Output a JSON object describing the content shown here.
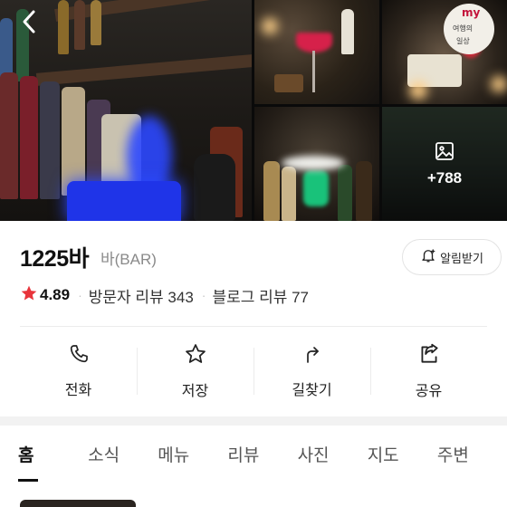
{
  "header": {
    "back_icon": "chevron-left-icon"
  },
  "gallery": {
    "more_photos_label": "+788",
    "more_photos_icon": "image-icon"
  },
  "place": {
    "name": "1225바",
    "category": "바(BAR)",
    "notify_label": "알림받기",
    "notify_icon": "bell-plus-icon",
    "rating": "4.89",
    "star_color": "#e8343b",
    "visitor_reviews": "방문자 리뷰 343",
    "blog_reviews": "블로그 리뷰 77"
  },
  "actions": [
    {
      "label": "전화",
      "icon": "phone-icon"
    },
    {
      "label": "저장",
      "icon": "star-outline-icon"
    },
    {
      "label": "길찾기",
      "icon": "directions-icon"
    },
    {
      "label": "공유",
      "icon": "share-icon"
    }
  ],
  "tabs": [
    {
      "label": "홈",
      "active": true
    },
    {
      "label": "소식"
    },
    {
      "label": "메뉴"
    },
    {
      "label": "리뷰"
    },
    {
      "label": "사진"
    },
    {
      "label": "지도"
    },
    {
      "label": "주변"
    }
  ]
}
